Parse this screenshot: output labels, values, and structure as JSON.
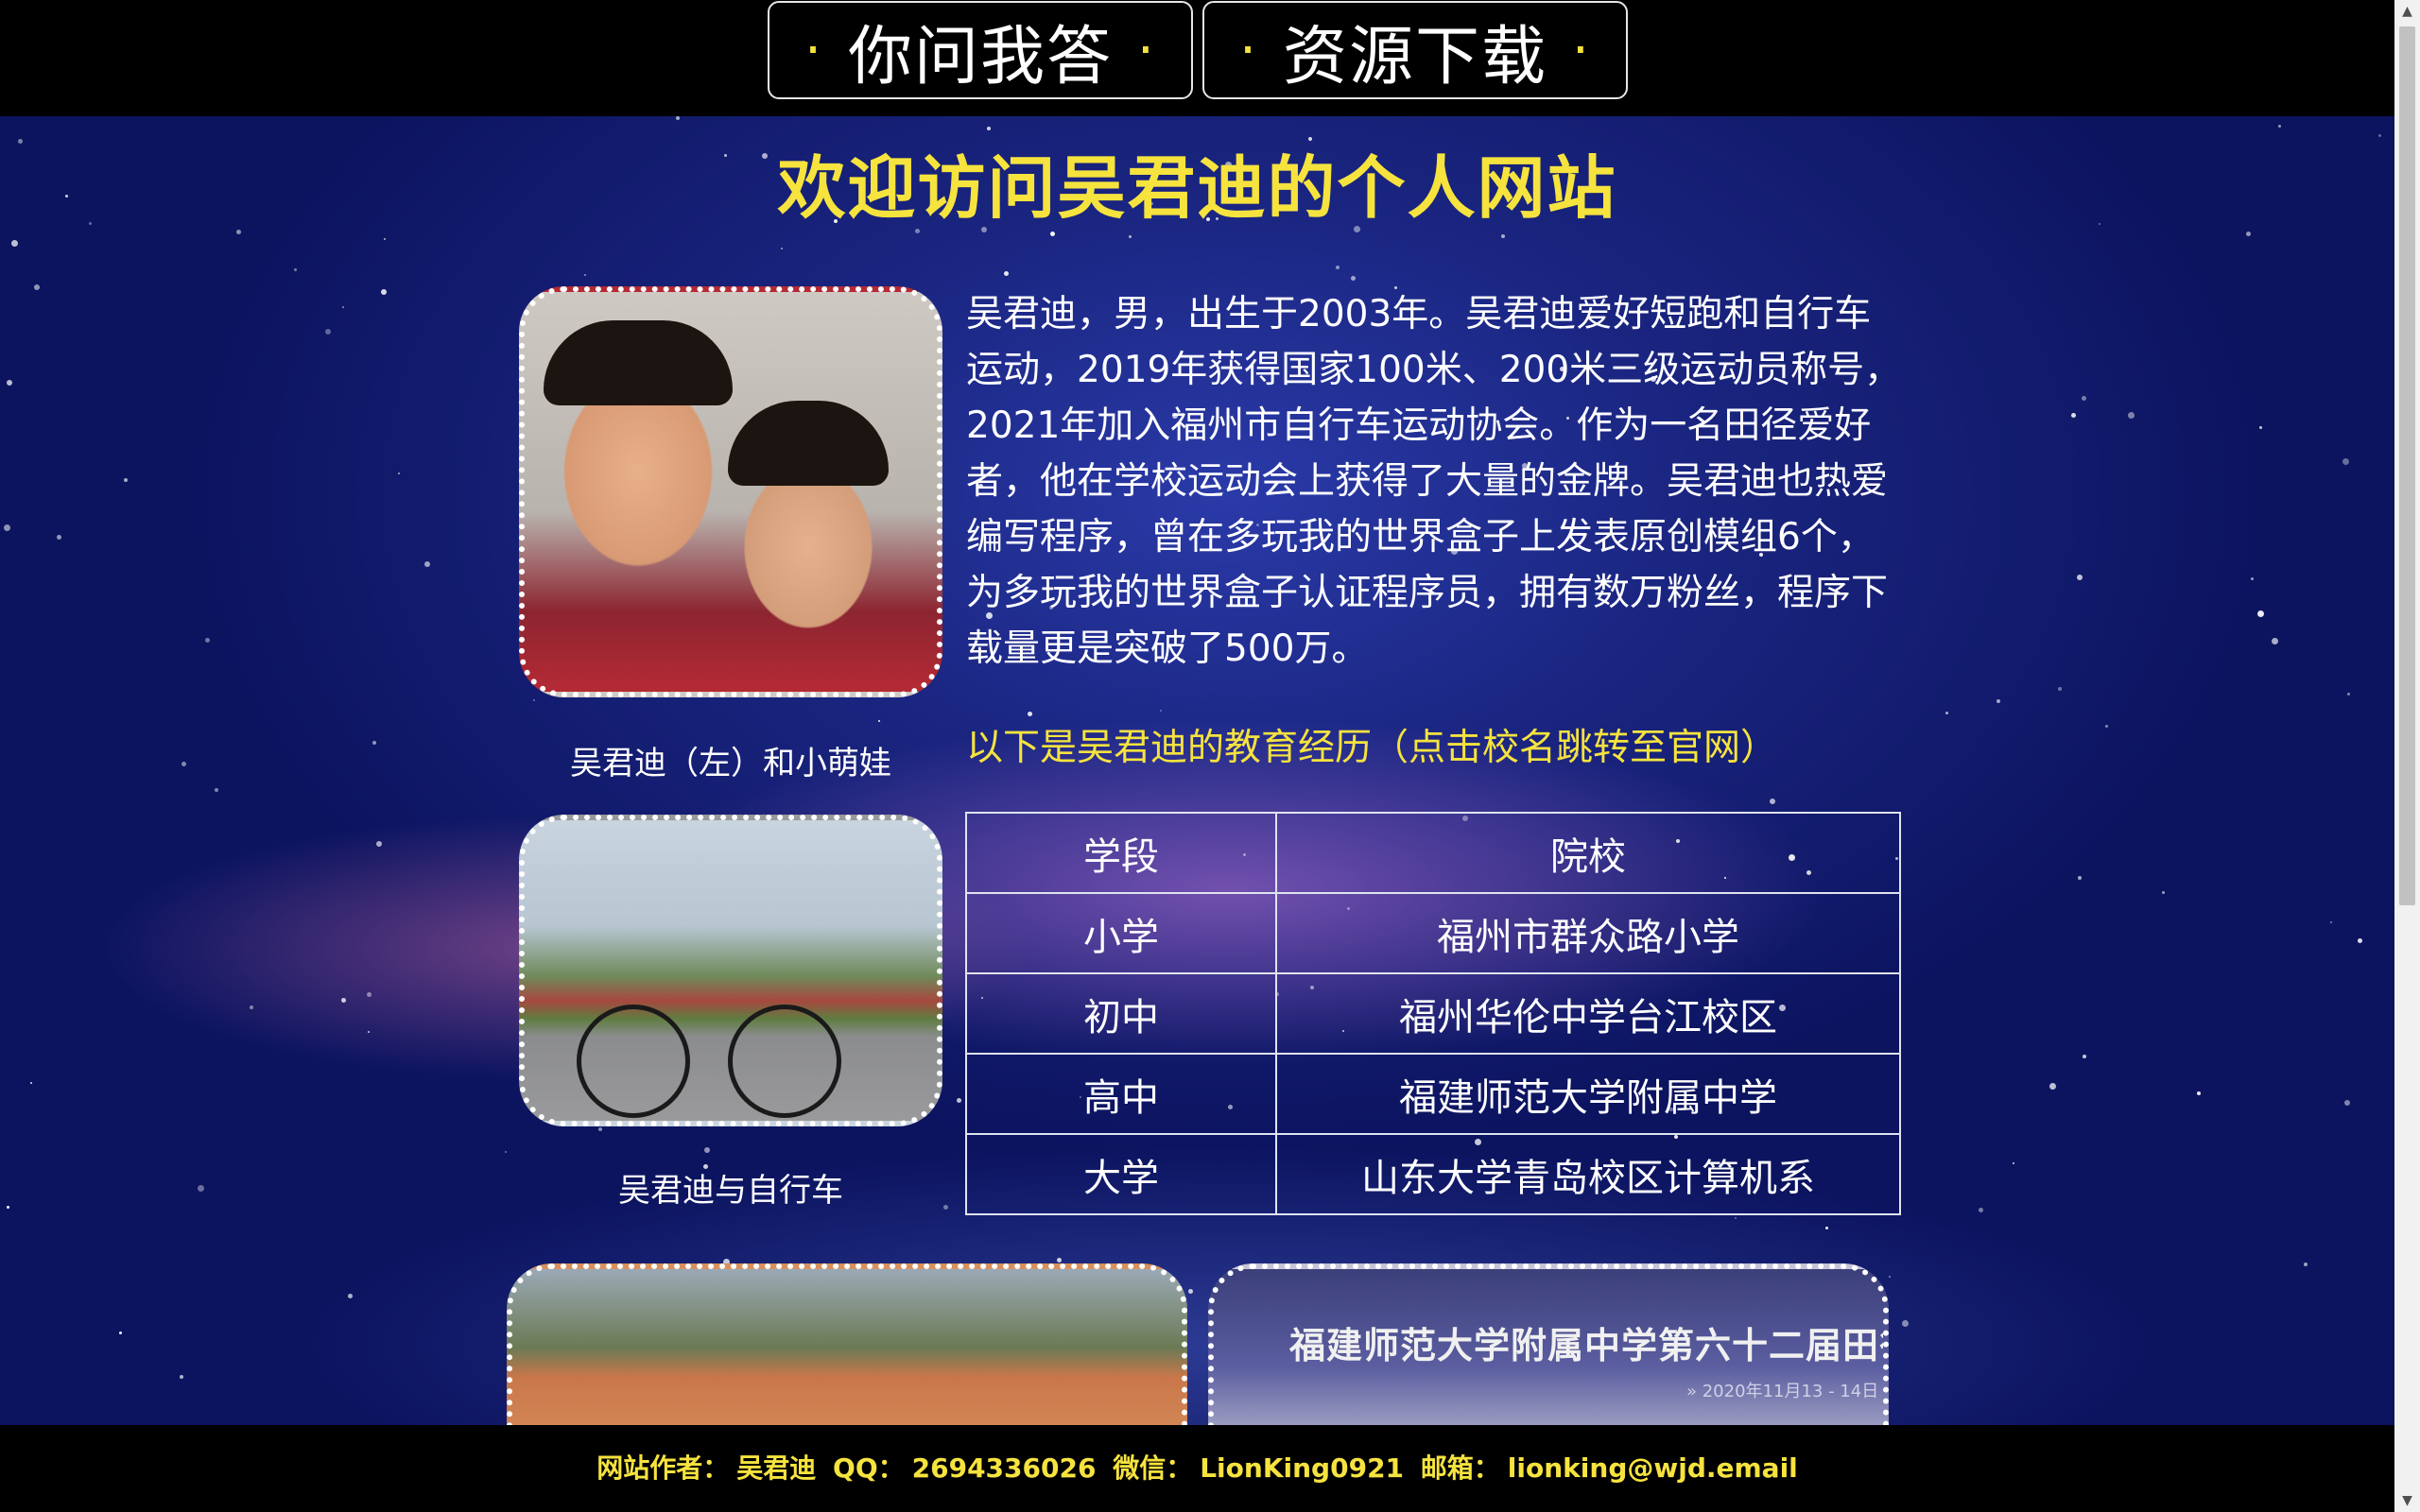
{
  "nav": {
    "qa_label": "你问我答",
    "download_label": "资源下载",
    "dot": "·"
  },
  "title": "欢迎访问吴君迪的个人网站",
  "bio": "吴君迪，男，出生于2003年。吴君迪爱好短跑和自行车运动，2019年获得国家100米、200米三级运动员称号，2021年加入福州市自行车运动协会。作为一名田径爱好者，他在学校运动会上获得了大量的金牌。吴君迪也热爱编写程序，曾在多玩我的世界盒子上发表原创模组6个，为多玩我的世界盒子认证程序员，拥有数万粉丝，程序下载量更是突破了500万。",
  "photos": {
    "caption_1": "吴君迪（左）和小萌娃",
    "caption_2": "吴君迪与自行车",
    "meet_banner": "福建师范大学附属中学第六十二届田径运动会",
    "meet_date": "» 2020年11月13 - 14日"
  },
  "education": {
    "intro": "以下是吴君迪的教育经历（点击校名跳转至官网）",
    "headers": [
      "学段",
      "院校"
    ],
    "rows": [
      [
        "小学",
        "福州市群众路小学"
      ],
      [
        "初中",
        "福州华伦中学台江校区"
      ],
      [
        "高中",
        "福建师范大学附属中学"
      ],
      [
        "大学",
        "山东大学青岛校区计算机系"
      ]
    ]
  },
  "footer": {
    "author_label": "网站作者：",
    "author": "吴君迪",
    "qq_label": "QQ：",
    "qq": "2694336026",
    "wechat_label": "微信：",
    "wechat": "LionKing0921",
    "email_label": "邮箱：",
    "email": "lionking@wjd.email"
  },
  "colors": {
    "accent_yellow": "#f6e33e",
    "nav_bg": "#000000",
    "sky_blue": "#1a2580"
  }
}
